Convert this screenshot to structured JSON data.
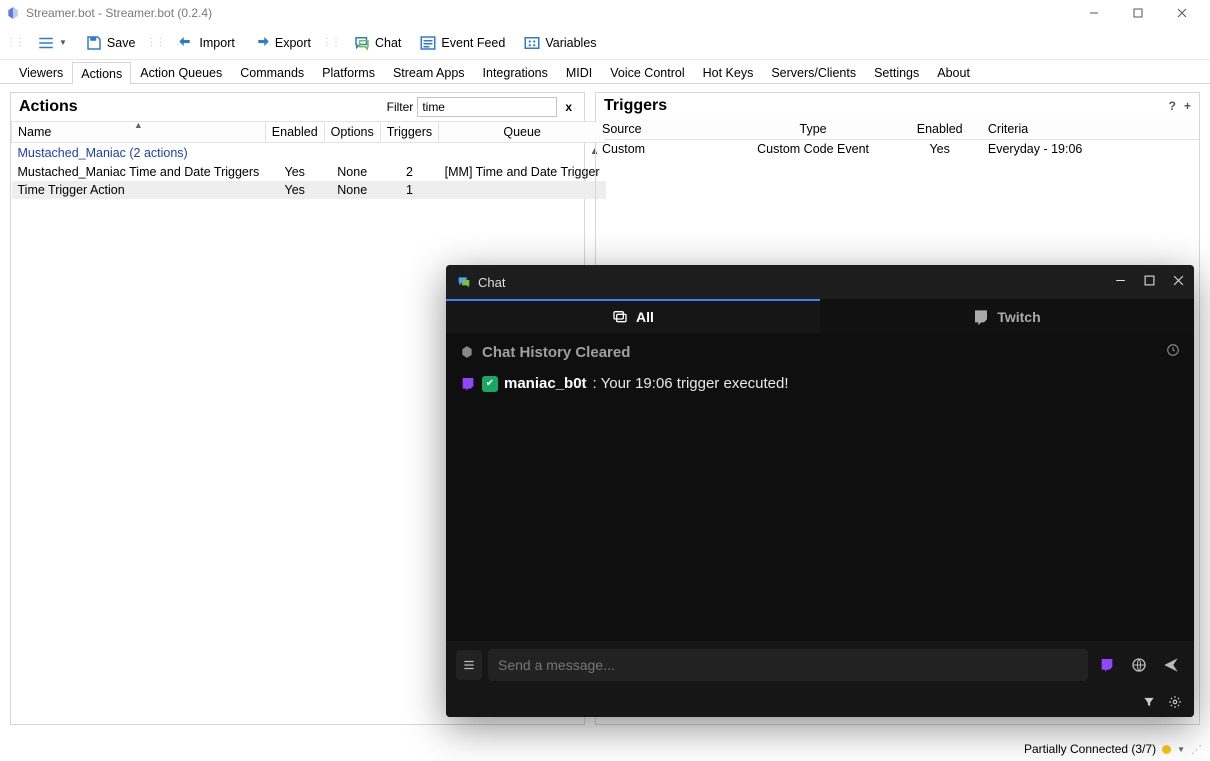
{
  "window": {
    "title": "Streamer.bot - Streamer.bot (0.2.4)"
  },
  "toolbar": {
    "save": "Save",
    "import": "Import",
    "export": "Export",
    "chat": "Chat",
    "event_feed": "Event Feed",
    "variables": "Variables"
  },
  "tabs": [
    "Viewers",
    "Actions",
    "Action Queues",
    "Commands",
    "Platforms",
    "Stream Apps",
    "Integrations",
    "MIDI",
    "Voice Control",
    "Hot Keys",
    "Servers/Clients",
    "Settings",
    "About"
  ],
  "actions": {
    "title": "Actions",
    "filter_label": "Filter",
    "filter_value": "time",
    "columns": [
      "Name",
      "Enabled",
      "Options",
      "Triggers",
      "Queue"
    ],
    "group": "Mustached_Maniac (2 actions)",
    "rows": [
      {
        "name": "Mustached_Maniac Time and Date Triggers",
        "enabled": "Yes",
        "options": "None",
        "triggers": "2",
        "queue": "[MM] Time and Date Trigger"
      },
      {
        "name": "Time Trigger Action",
        "enabled": "Yes",
        "options": "None",
        "triggers": "1",
        "queue": ""
      }
    ]
  },
  "triggers": {
    "title": "Triggers",
    "columns": [
      "Source",
      "Type",
      "Enabled",
      "Criteria"
    ],
    "help": "?",
    "add": "+",
    "rows": [
      {
        "source": "Custom",
        "type": "Custom Code Event",
        "enabled": "Yes",
        "criteria": "Everyday - 19:06"
      }
    ]
  },
  "status": {
    "text": "Partially Connected (3/7)"
  },
  "chat": {
    "title": "Chat",
    "tabs": {
      "all": "All",
      "twitch": "Twitch"
    },
    "system_msg": "Chat History Cleared",
    "message": {
      "user": "maniac_b0t",
      "text": ": Your 19:06 trigger executed!"
    },
    "input_placeholder": "Send a message..."
  }
}
